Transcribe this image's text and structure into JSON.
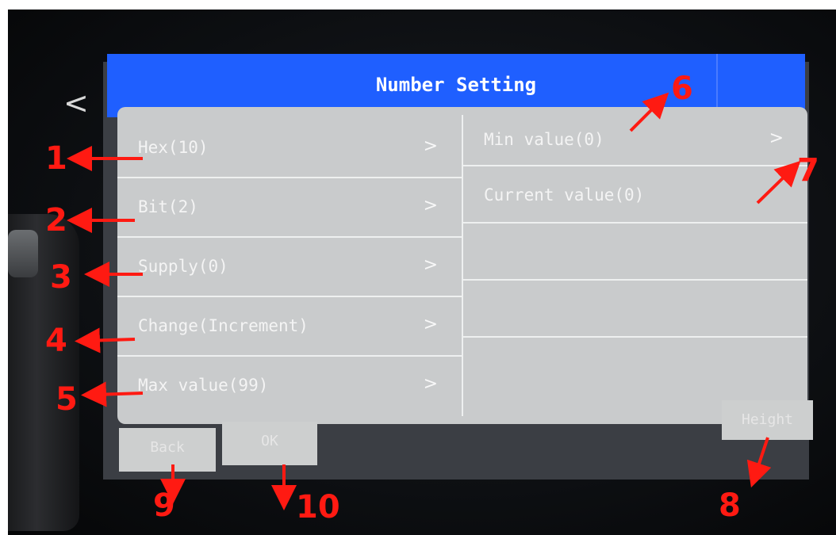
{
  "screen": {
    "title": "Number Setting",
    "back_glyph": "<",
    "left_items": [
      {
        "label": "Hex(10)",
        "chevron": ">"
      },
      {
        "label": "Bit(2)",
        "chevron": ">"
      },
      {
        "label": "Supply(0)",
        "chevron": ">"
      },
      {
        "label": "Change(Increment)",
        "chevron": ">"
      },
      {
        "label": "Max value(99)",
        "chevron": ">"
      }
    ],
    "right_items": [
      {
        "label": "Min value(0)",
        "chevron": ">"
      },
      {
        "label": "Current value(0)"
      }
    ],
    "buttons": {
      "back": "Back",
      "ok": "OK",
      "height": "Height"
    }
  },
  "annotations": [
    "1",
    "2",
    "3",
    "4",
    "5",
    "6",
    "7",
    "8",
    "9",
    "10"
  ],
  "colors": {
    "titlebar": "#1f5fff",
    "annotation": "#ff1a12"
  }
}
